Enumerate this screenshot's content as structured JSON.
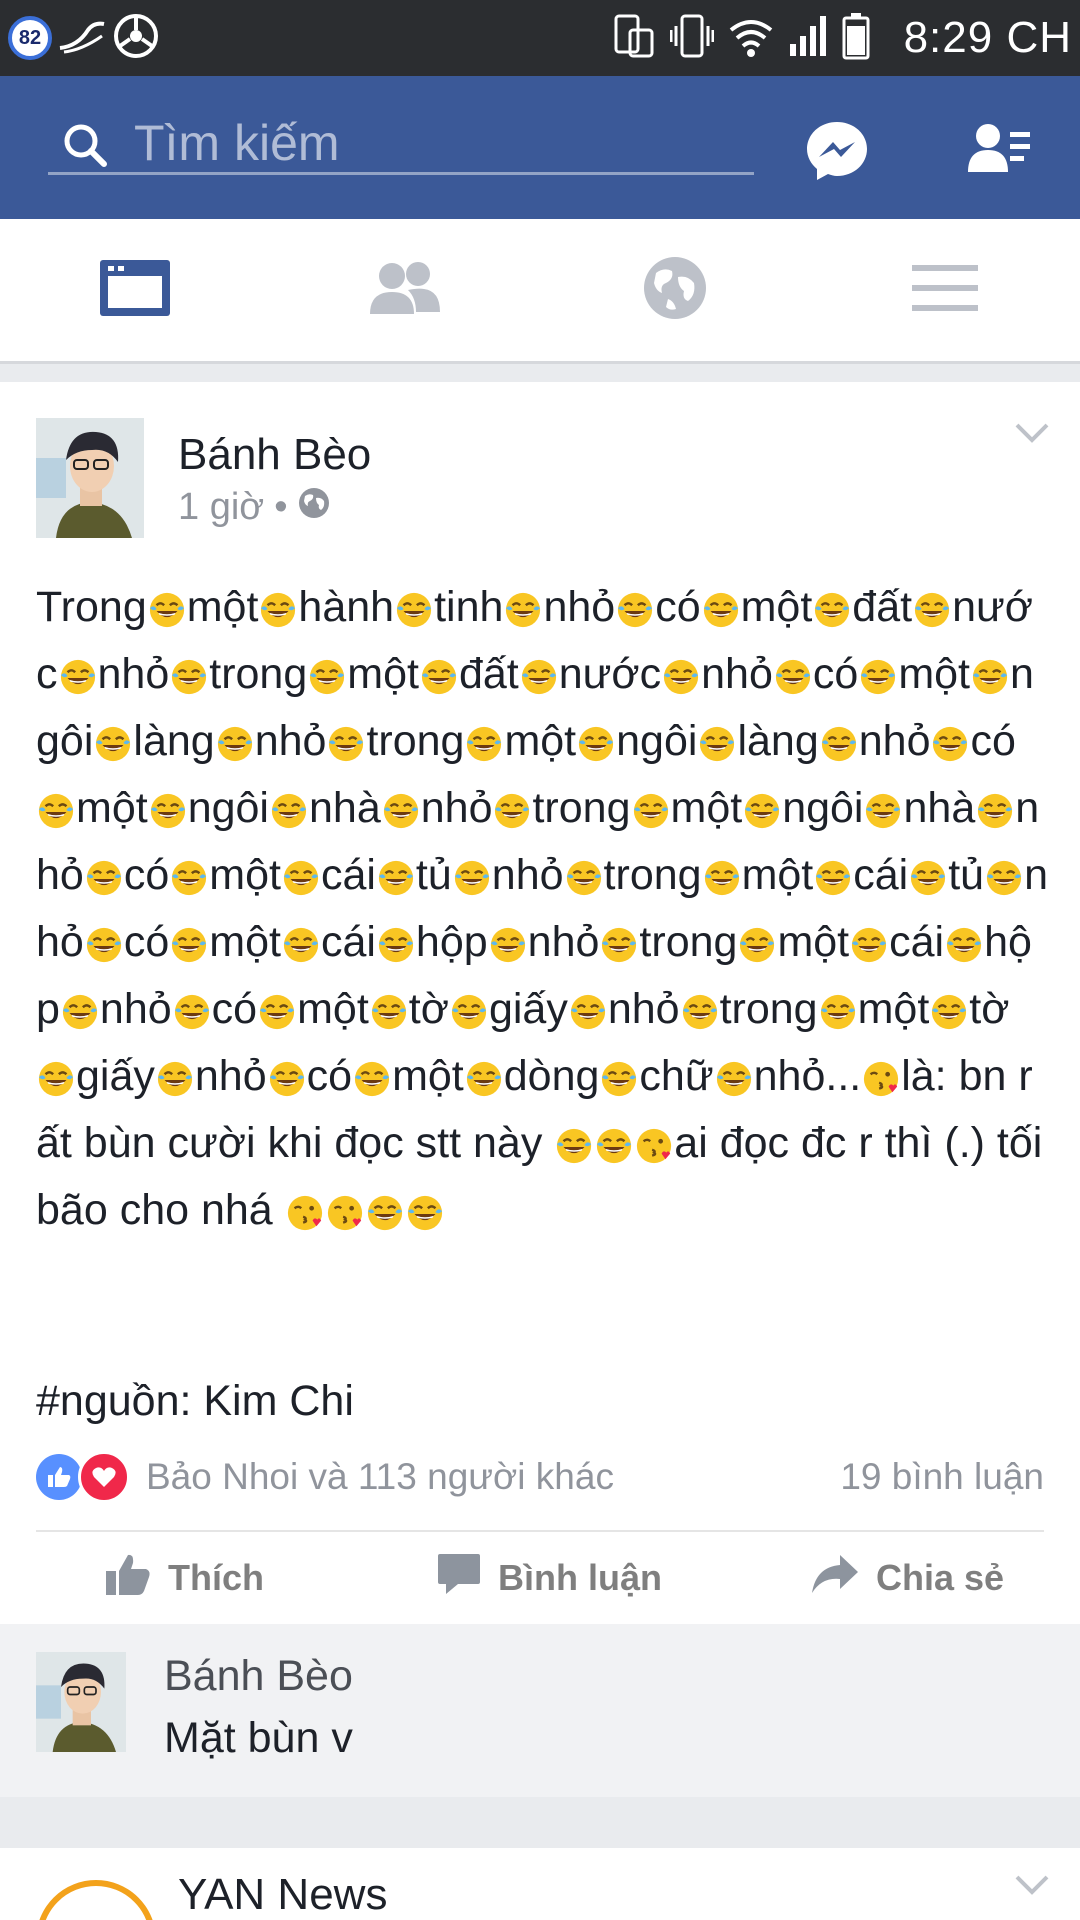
{
  "status_bar": {
    "battery_level": "82",
    "time": "8:29 CH"
  },
  "header": {
    "search_placeholder": "Tìm kiếm",
    "icons": [
      "search-icon",
      "messenger-icon",
      "friend-requests-icon"
    ]
  },
  "tabs": [
    {
      "name": "news-feed",
      "icon": "news-feed-icon",
      "active": true
    },
    {
      "name": "friends",
      "icon": "friends-icon",
      "active": false
    },
    {
      "name": "notifications",
      "icon": "globe-icon",
      "active": false
    },
    {
      "name": "menu",
      "icon": "menu-icon",
      "active": false
    }
  ],
  "post": {
    "author": "Bánh Bèo",
    "time": "1 giờ",
    "separator": "•",
    "privacy_icon": "globe-icon",
    "text_segments": [
      "Trong",
      "L",
      "một",
      "L",
      "hành",
      "L",
      "tinh",
      "L",
      "nhỏ",
      "L",
      "có",
      "L",
      "một",
      "L",
      "đất",
      "L",
      "nước",
      "L",
      "nhỏ",
      "L",
      "trong",
      "L",
      "một",
      "L",
      "đất",
      "L",
      "nước",
      "L",
      "nhỏ",
      "L",
      "có",
      "L",
      "một",
      "L",
      "ngôi",
      "L",
      "làng",
      "L",
      "nhỏ",
      "L",
      "trong",
      "L",
      "một",
      "L",
      "ngôi",
      "L",
      "làng",
      "L",
      "nhỏ",
      "L",
      "có",
      "L",
      "một",
      "L",
      "ngôi",
      "L",
      "nhà",
      "L",
      "nhỏ",
      "L",
      "trong",
      "L",
      "một",
      "L",
      "ngôi",
      "L",
      "nhà",
      "L",
      "nhỏ",
      "L",
      "có",
      "L",
      "một",
      "L",
      "cái",
      "L",
      "tủ",
      "L",
      "nhỏ",
      "L",
      "trong",
      "L",
      "một",
      "L",
      "cái",
      "L",
      "tủ",
      "L",
      "nhỏ",
      "L",
      "có",
      "L",
      "một",
      "L",
      "cái",
      "L",
      "hộp",
      "L",
      "nhỏ",
      "L",
      "trong",
      "L",
      "một",
      "L",
      "cái",
      "L",
      "hộp",
      "L",
      "nhỏ",
      "L",
      "có",
      "L",
      "một",
      "L",
      "tờ",
      "L",
      "giấy",
      "L",
      "nhỏ",
      "L",
      "trong",
      "L",
      "một",
      "L",
      "tờ",
      "L",
      "giấy",
      "L",
      "nhỏ",
      "L",
      "có",
      "L",
      "một",
      "L",
      "dòng",
      "L",
      "chữ",
      "L",
      "nhỏ...",
      "K",
      "là: bn rất bùn cười khi đọc stt này ",
      "L",
      "L",
      "K",
      "ai đọc đc r thì (.) tối bão cho nhá ",
      "K",
      "K",
      "L",
      "L"
    ],
    "hashtag_line": "#nguồn: Kim Chi",
    "reactions_text": "Bảo Nhoi và 113 người khác",
    "comments_count": "19 bình luận",
    "actions": {
      "like": "Thích",
      "comment": "Bình luận",
      "share": "Chia sẻ"
    },
    "emoji_legend": {
      "L": "laughing-tears-emoji",
      "K": "kissing-emoji"
    }
  },
  "comment": {
    "author": "Bánh Bèo",
    "text": "Mặt bùn v"
  },
  "next_post": {
    "author": "YAN News"
  },
  "colors": {
    "facebook_blue": "#3b5998",
    "like_blue": "#5890ff",
    "love_red": "#f0284a"
  }
}
